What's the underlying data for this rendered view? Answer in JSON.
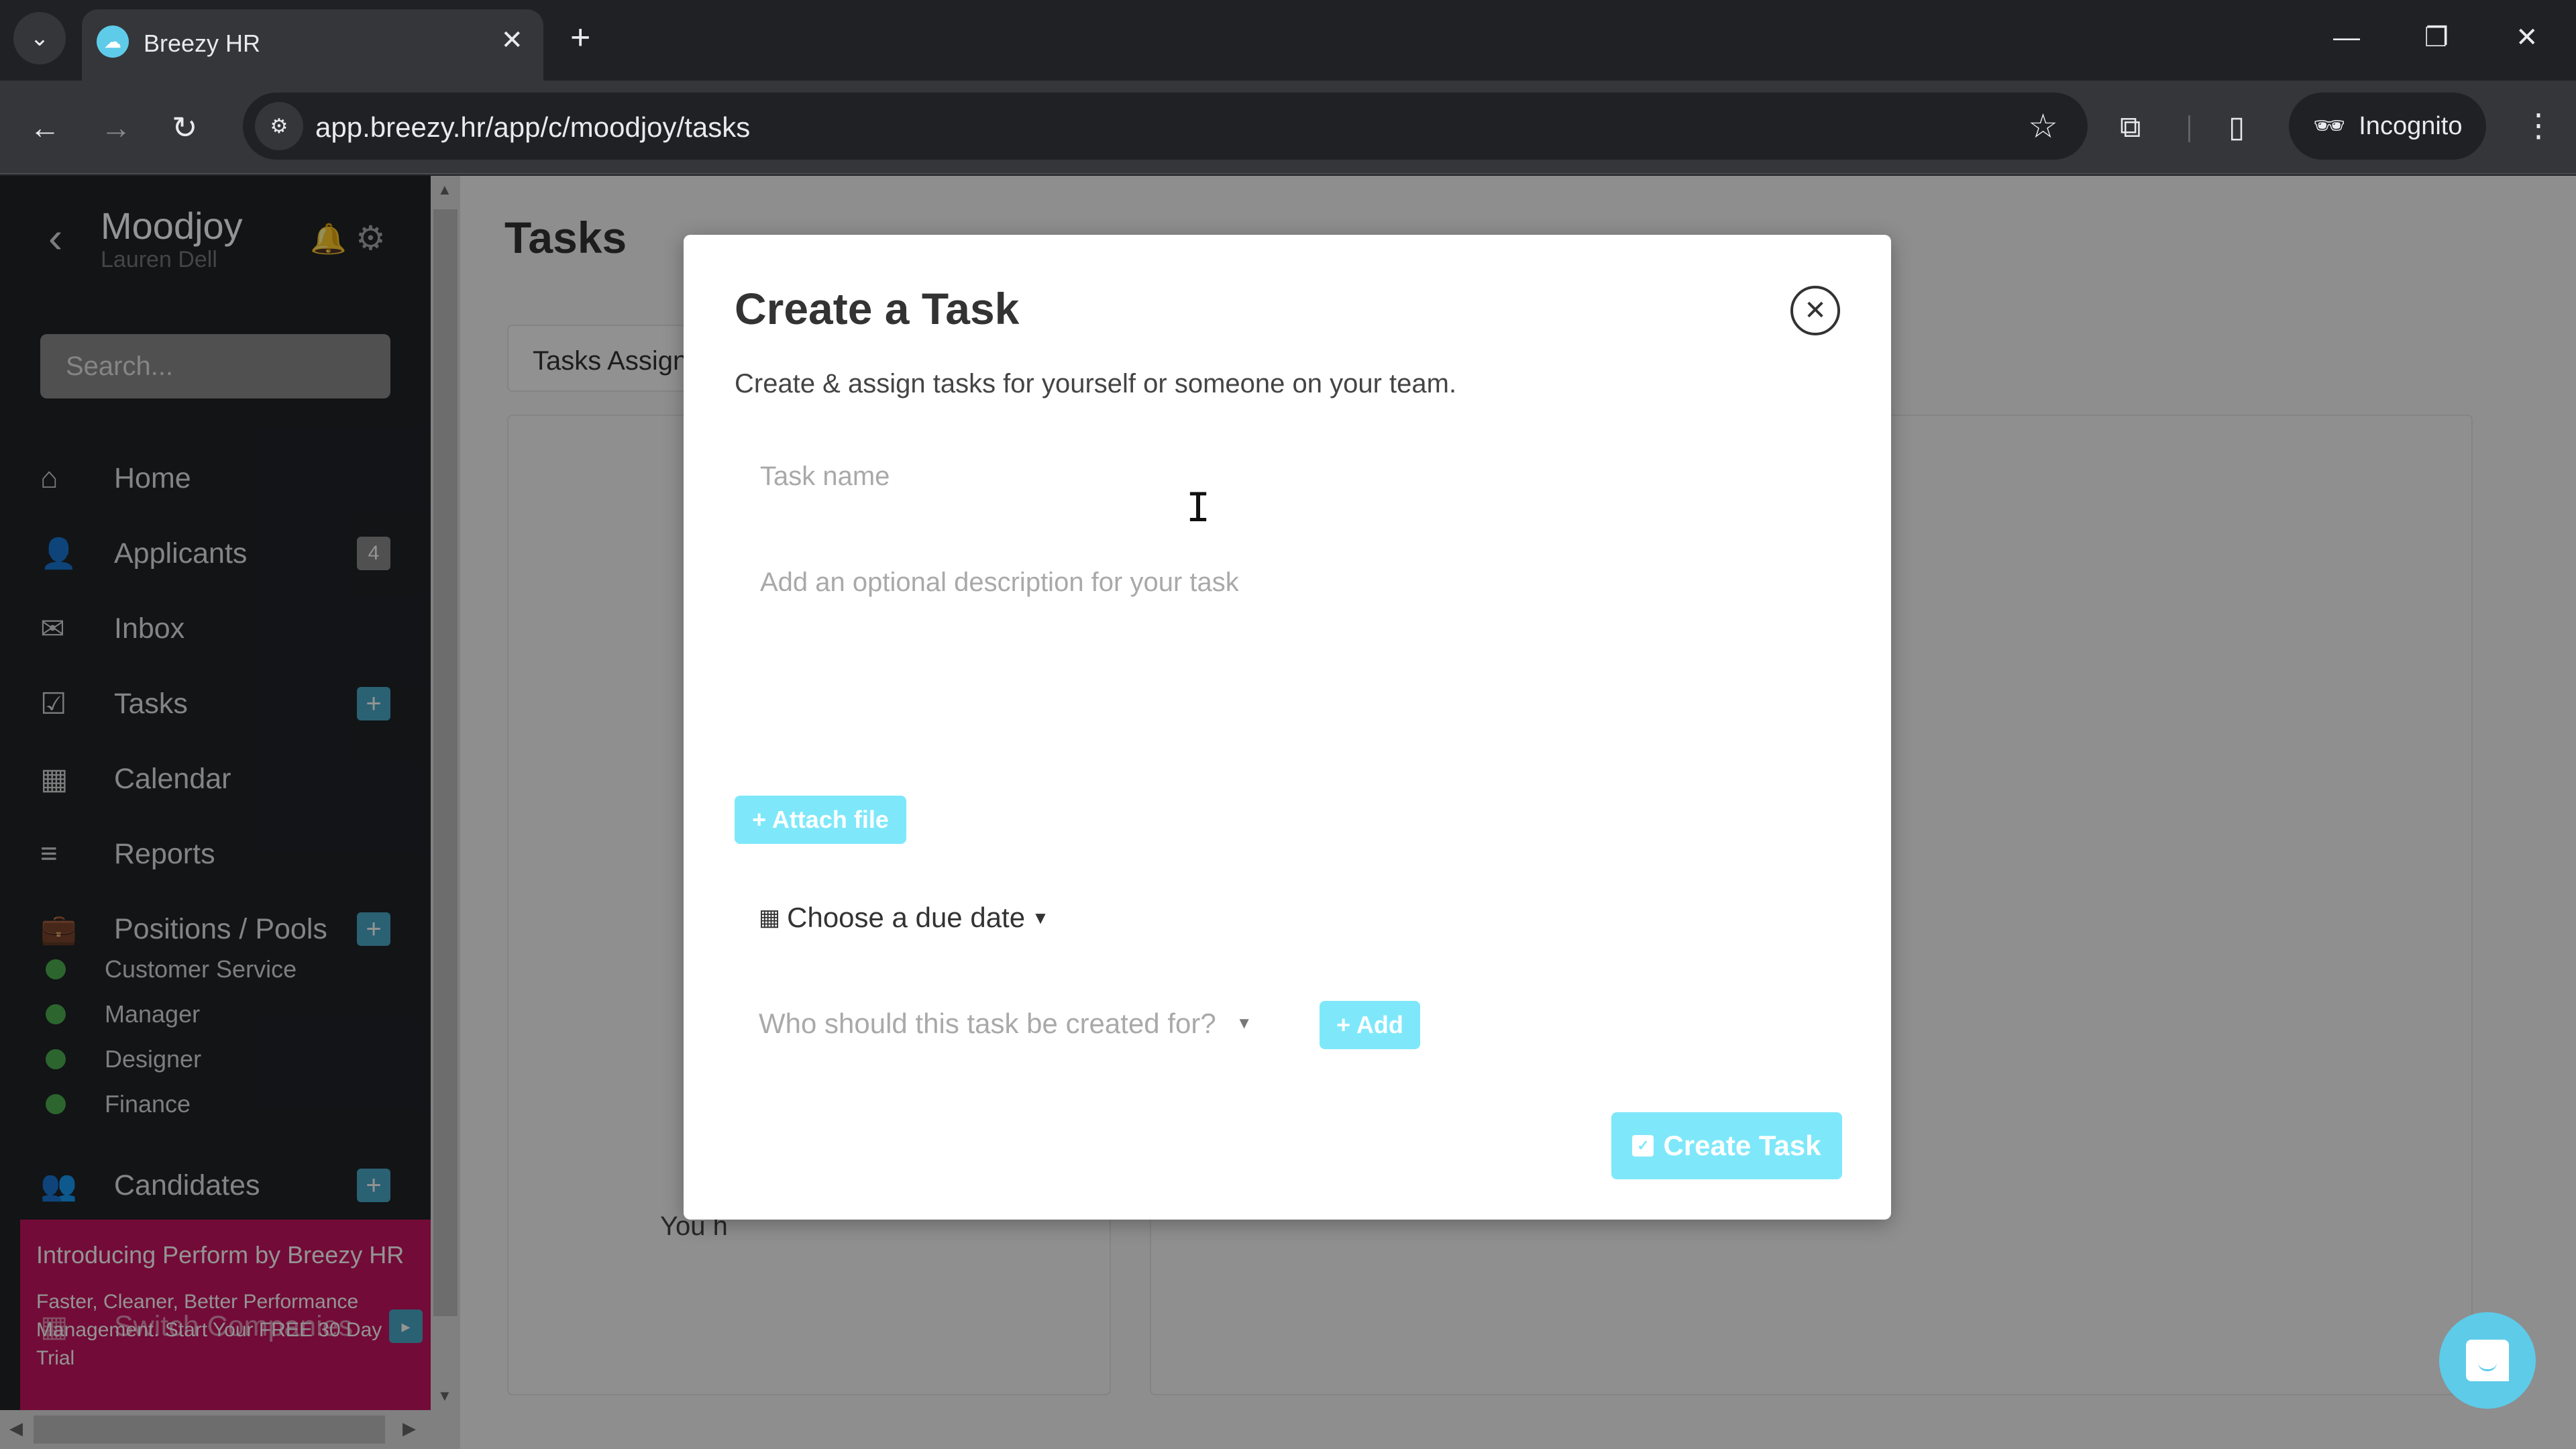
{
  "browser": {
    "tab_search_icon": "chevron-down",
    "tab": {
      "title": "Breezy HR",
      "favicon": "breezy-cloud-icon",
      "close": "✕"
    },
    "new_tab": "+",
    "window_controls": {
      "minimize": "—",
      "restore": "❐",
      "close": "✕"
    },
    "nav": {
      "back": "←",
      "forward": "→",
      "reload": "↻"
    },
    "url": "app.breezy.hr/app/c/moodjoy/tasks",
    "site_info_icon": "⚙",
    "bookmark_icon": "☆",
    "extensions_icon": "⧉",
    "sidepanel_icon": "▯",
    "incognito_label": "Incognito",
    "menu_icon": "⋮"
  },
  "sidebar": {
    "company": "Moodjoy",
    "user": "Lauren Dell",
    "search_placeholder": "Search...",
    "items": [
      {
        "label": "Home",
        "icon": "home-icon",
        "glyph": "⌂"
      },
      {
        "label": "Applicants",
        "icon": "user-icon",
        "glyph": "👤",
        "badge": "4"
      },
      {
        "label": "Inbox",
        "icon": "envelope-icon",
        "glyph": "✉"
      },
      {
        "label": "Tasks",
        "icon": "checkbox-icon",
        "glyph": "☑",
        "plus": "+"
      },
      {
        "label": "Calendar",
        "icon": "calendar-icon",
        "glyph": "▦"
      },
      {
        "label": "Reports",
        "icon": "bar-chart-icon",
        "glyph": "≡"
      },
      {
        "label": "Positions / Pools",
        "icon": "briefcase-icon",
        "glyph": "💼",
        "plus": "+"
      },
      {
        "label": "Candidates",
        "icon": "users-icon",
        "glyph": "👥",
        "plus": "+"
      }
    ],
    "positions": [
      {
        "label": "Customer Service",
        "status_color": "#4caf50"
      },
      {
        "label": "Manager",
        "status_color": "#4caf50"
      },
      {
        "label": "Designer",
        "status_color": "#4caf50"
      },
      {
        "label": "Finance",
        "status_color": "#4caf50"
      }
    ],
    "promo": {
      "title": "Introducing Perform by Breezy HR",
      "body": "Faster, Cleaner, Better Performance Management. Start Your FREE 30 Day Trial"
    },
    "switch_companies": {
      "label": "Switch Companies",
      "arrow": "▸"
    }
  },
  "main": {
    "title": "Tasks",
    "tab_label": "Tasks Assigned",
    "empty_message": "You h"
  },
  "modal": {
    "title": "Create a Task",
    "subtitle": "Create & assign tasks for yourself or someone on your team.",
    "close_icon": "✕",
    "task_name_placeholder": "Task name",
    "task_name_value": "",
    "description_placeholder": "Add an optional description for your task",
    "description_value": "",
    "attach_label": "+ Attach file",
    "due_date_label": "Choose a due date",
    "assignee_placeholder": "Who should this task be created for?",
    "add_label": "+ Add",
    "create_label": "Create Task",
    "accent_color": "#7ee8fa"
  },
  "colors": {
    "brand_cyan": "#5ecbe9",
    "sidebar_bg": "#1f2327",
    "promo_bg": "#c4145f",
    "sidebar_plus": "#49a7c7"
  }
}
